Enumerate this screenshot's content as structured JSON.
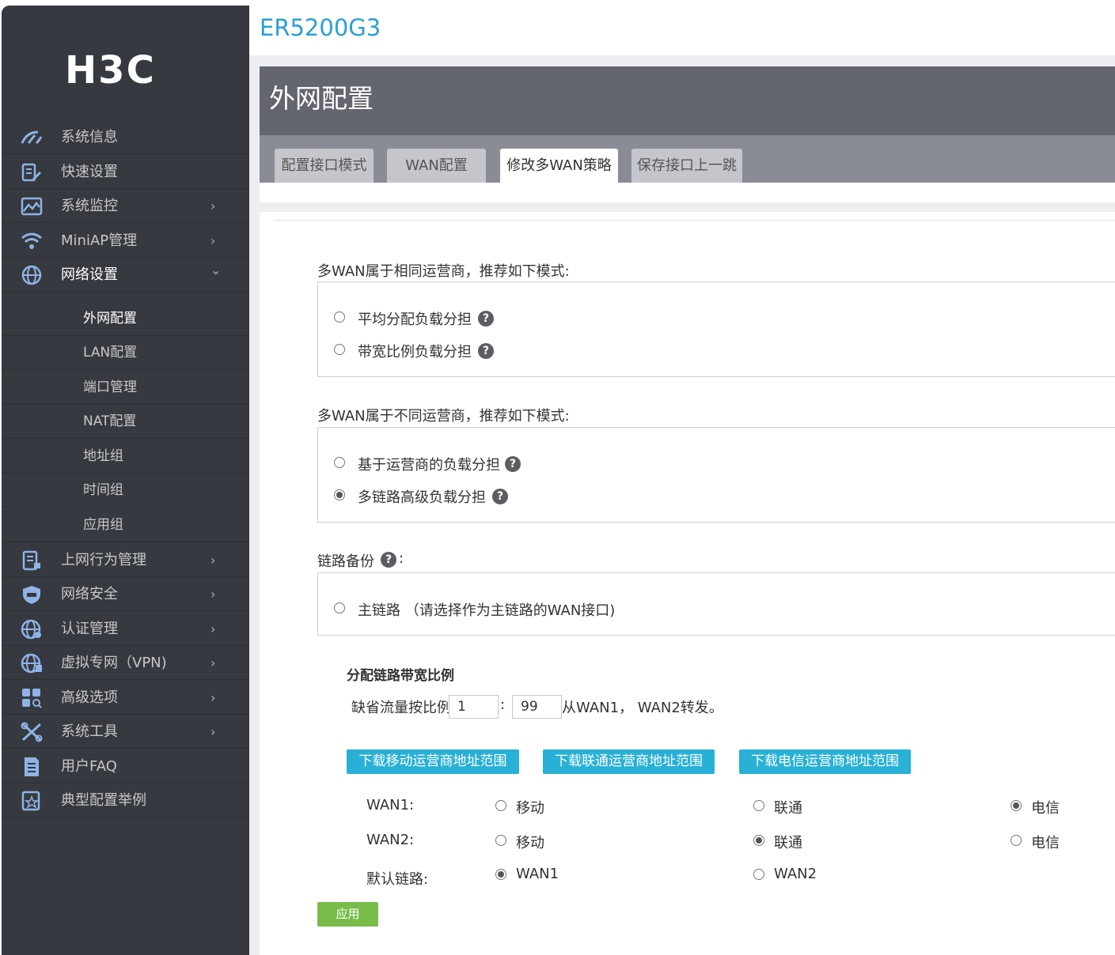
{
  "app": {
    "model": "ER5200G3",
    "logo_text": "H3C"
  },
  "sidebar": {
    "items": [
      {
        "label": "系统信息",
        "icon": "gauge-icon",
        "chevron": ""
      },
      {
        "label": "快速设置",
        "icon": "quick-setup-icon",
        "chevron": ""
      },
      {
        "label": "系统监控",
        "icon": "monitor-icon",
        "chevron": "›"
      },
      {
        "label": "MiniAP管理",
        "icon": "wifi-icon",
        "chevron": "›"
      },
      {
        "label": "网络设置",
        "icon": "globe-icon",
        "chevron": "⌄"
      },
      {
        "label": "上网行为管理",
        "icon": "behavior-icon",
        "chevron": "›"
      },
      {
        "label": "网络安全",
        "icon": "shield-icon",
        "chevron": "›"
      },
      {
        "label": "认证管理",
        "icon": "auth-globe-icon",
        "chevron": "›"
      },
      {
        "label": "虚拟专网（VPN)",
        "icon": "vpn-globe-icon",
        "chevron": "›"
      },
      {
        "label": "高级选项",
        "icon": "grid-icon",
        "chevron": "›"
      },
      {
        "label": "系统工具",
        "icon": "tools-icon",
        "chevron": "›"
      },
      {
        "label": "用户FAQ",
        "icon": "document-icon",
        "chevron": ""
      },
      {
        "label": "典型配置举例",
        "icon": "config-example-icon",
        "chevron": ""
      }
    ],
    "subitems": [
      "外网配置",
      "LAN配置",
      "端口管理",
      "NAT配置",
      "地址组",
      "时间组",
      "应用组"
    ]
  },
  "page": {
    "title": "外网配置"
  },
  "tabs": [
    "配置接口模式",
    "WAN配置",
    "修改多WAN策略",
    "保存接口上一跳"
  ],
  "same_isp": {
    "label": "多WAN属于相同运营商，推荐如下模式:",
    "options": [
      "平均分配负载分担",
      "带宽比例负载分担"
    ]
  },
  "diff_isp": {
    "label": "多WAN属于不同运营商，推荐如下模式:",
    "options": [
      "基于运营商的负载分担",
      "多链路高级负载分担"
    ]
  },
  "backup": {
    "label": "链路备份",
    "colon": ":",
    "option": "主链路 （请选择作为主链路的WAN接口)"
  },
  "ratio": {
    "title": "分配链路带宽比例",
    "prefix": "缺省流量按比例",
    "separator": ":",
    "value1": "1",
    "value2": "99",
    "suffix": "从WAN1， WAN2转发。"
  },
  "downloads": [
    "下载移动运营商地址范围",
    "下载联通运营商地址范围",
    "下载电信运营商地址范围"
  ],
  "isp_table": {
    "rows": [
      {
        "label": "WAN1:",
        "options": [
          "移动",
          "联通",
          "电信"
        ],
        "selected": 2
      },
      {
        "label": "WAN2:",
        "options": [
          "移动",
          "联通",
          "电信"
        ],
        "selected": 1
      },
      {
        "label": "默认链路:",
        "options": [
          "WAN1",
          "WAN2"
        ],
        "selected": 0
      }
    ]
  },
  "apply_label": "应用",
  "help_glyph": "?"
}
